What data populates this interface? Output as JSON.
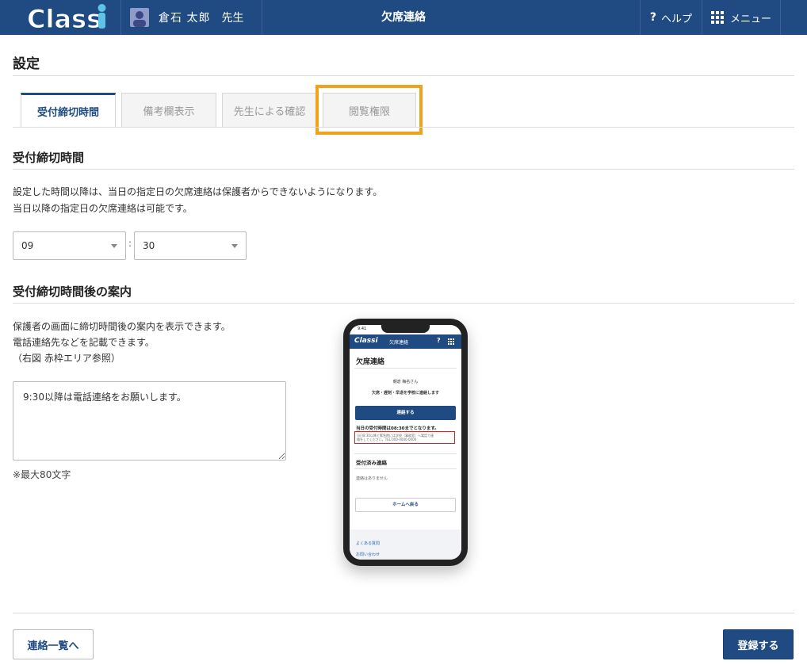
{
  "header": {
    "logo_text": "Classi",
    "user_name": "倉石 太郎",
    "user_role": "先生",
    "title": "欠席連絡",
    "help_label": "ヘルプ",
    "help_icon": "question-icon",
    "menu_label": "メニュー",
    "menu_icon": "grid-icon"
  },
  "settings_title": "設定",
  "tabs": [
    {
      "label": "受付締切時間",
      "active": true
    },
    {
      "label": "備考欄表示",
      "active": false
    },
    {
      "label": "先生による確認",
      "active": false
    },
    {
      "label": "閲覧権限",
      "active": false
    }
  ],
  "deadline": {
    "heading": "受付締切時間",
    "desc1": "設定した時間以降は、当日の指定日の欠席連絡は保護者からできないようになります。",
    "desc2": "当日以降の指定日の欠席連絡は可能です。",
    "hour": "09",
    "separator": ":",
    "minute": "30"
  },
  "guide": {
    "heading": "受付締切時間後の案内",
    "desc1": "保護者の画面に締切時間後の案内を表示できます。",
    "desc2": "電話連絡先などを記載できます。",
    "desc3": "（右図 赤枠エリア参照）",
    "textarea_value": "9:30以降は電話連絡をお願いします。",
    "hint": "※最大80文字"
  },
  "phone": {
    "time": "9:41",
    "logo": "Classi",
    "bar_title": "欠席連絡",
    "help": "?",
    "page_title": "欠席連絡",
    "student": "朝倉 梅名さん",
    "prompt": "欠席・遅刻・早退を学校に連絡します",
    "contact_button": "連絡する",
    "deadline_note": "当日の受付時間は08:30までとなります。",
    "red_note_1": "当日8:30以降と緊急時には学校（事務室）へ電話で連",
    "red_note_2": "絡をしてください。TEL:000-0000-0000",
    "received_heading": "受付済み連絡",
    "no_contacts": "連絡はありません",
    "home_button": "ホームへ戻る",
    "faq": "よくある質問",
    "inquiry": "お問い合わせ"
  },
  "footer": {
    "back_button": "連絡一覧へ",
    "submit_button": "登録する"
  },
  "colors": {
    "brand": "#1f4a82",
    "highlight": "#f0a21b",
    "phone_note_border": "#e02020"
  }
}
